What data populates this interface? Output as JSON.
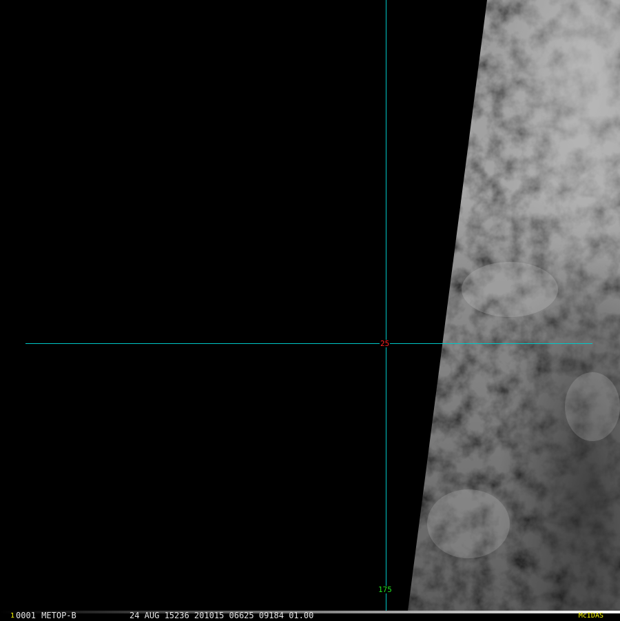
{
  "imagery": {
    "description_colors": {
      "background": "#000000",
      "gridline": "#00c8c8",
      "latitude_label": "#ff2020",
      "longitude_label": "#20e020",
      "brand": "#ffff00"
    }
  },
  "grid": {
    "latitude_label": "25",
    "longitude_label": "175"
  },
  "status_bar": {
    "frame_number": "1",
    "image_id": "0001",
    "satellite": "METOP-B",
    "date_time": "24 AUG 15236 201015 06625 09184 01.00",
    "brand": "McIDAS"
  }
}
